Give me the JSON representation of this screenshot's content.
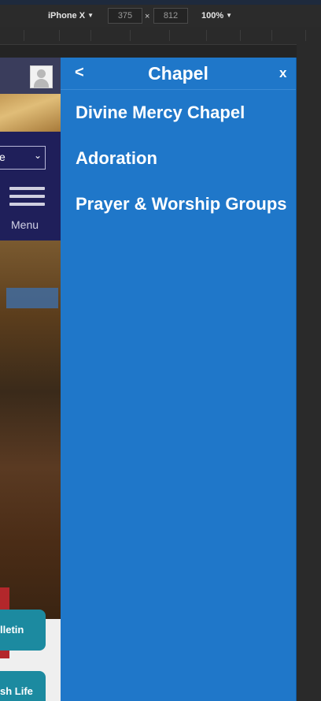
{
  "devtools": {
    "device": "iPhone X",
    "width": "375",
    "times": "×",
    "height": "812",
    "zoom": "100%"
  },
  "site": {
    "select_text": "e",
    "menu_label": "Menu",
    "tiles": [
      "lletin",
      "sh Life"
    ]
  },
  "drawer": {
    "back_label": "<",
    "title": "Chapel",
    "close_label": "x",
    "items": [
      {
        "label": "Divine Mercy Chapel"
      },
      {
        "label": "Adoration"
      },
      {
        "label": "Prayer & Worship Groups"
      }
    ]
  },
  "colors": {
    "drawer_bg": "#1f77c9",
    "site_nav": "#1f1f5a",
    "tile": "#1c8aa0"
  }
}
